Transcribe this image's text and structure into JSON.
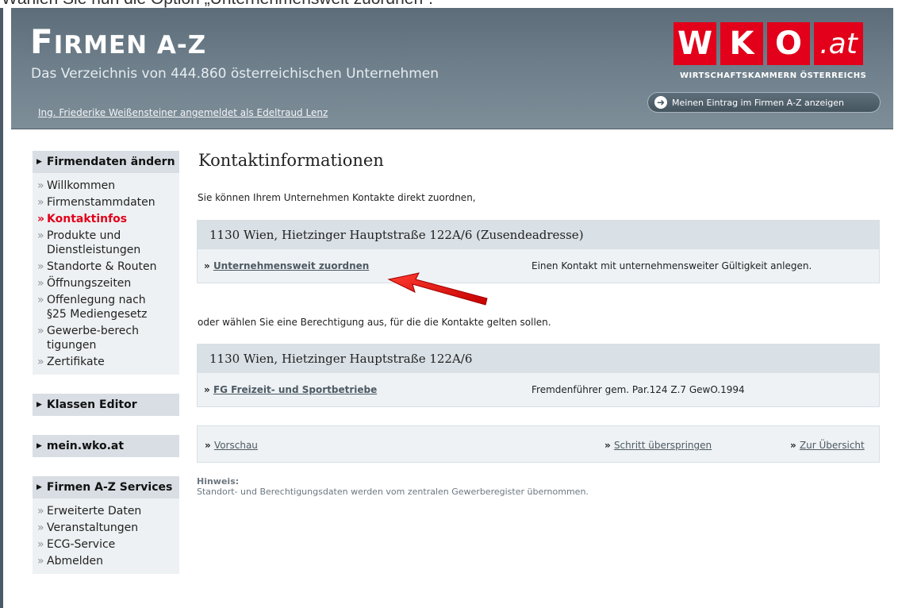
{
  "caption": "Wählen Sie nun die Option „Unternehmensweit zuordnen“.",
  "header": {
    "title_first": "F",
    "title_rest": "IRMEN A-Z",
    "subtitle": "Das Verzeichnis von 444.860 österreichischen Unternehmen",
    "login_text": "Ing. Friederike Weißensteiner angemeldet als Edeltraud Lenz",
    "logo_letters": [
      "W",
      "K",
      "O"
    ],
    "logo_suffix": ".at",
    "logo_tagline": "WIRTSCHAFTSKAMMERN ÖSTERREICHS",
    "show_entry_label": "Meinen Eintrag im Firmen A-Z anzeigen",
    "brand_color": "#e2001a"
  },
  "sidebar": {
    "section1": {
      "title": "Firmendaten ändern",
      "items": [
        "Willkommen",
        "Firmenstammdaten",
        "Kontaktinfos",
        "Produkte und Dienstleistungen",
        "Standorte & Routen",
        "Öffnungszeiten",
        "Offenlegung nach §25 Mediengesetz",
        "Gewerbe-berechtigungen",
        "Zertifikate"
      ],
      "active_index": 2
    },
    "section2": {
      "title": "Klassen Editor"
    },
    "section3": {
      "title": "mein.wko.at"
    },
    "section4": {
      "title": "Firmen A-Z Services",
      "items": [
        "Erweiterte Daten",
        "Veranstaltungen",
        "ECG-Service",
        "Abmelden"
      ]
    }
  },
  "main": {
    "title": "Kontaktinformationen",
    "intro": "Sie können Ihrem Unternehmen Kontakte direkt zuordnen,",
    "panel1": {
      "address": "1130 Wien, Hietzinger Hauptstraße 122A/6 (Zusendeadresse)",
      "link": "Unternehmensweit zuordnen",
      "desc": "Einen Kontakt mit unternehmensweiter Gültigkeit anlegen."
    },
    "mid_text": "oder wählen Sie eine Berechtigung aus, für die die Kontakte gelten sollen.",
    "panel2": {
      "address": "1130 Wien, Hietzinger Hauptstraße 122A/6",
      "link": "FG Freizeit- und Sportbetriebe",
      "desc": "Fremdenführer gem. Par.124 Z.7 GewO.1994"
    },
    "nav": {
      "preview": "Vorschau",
      "skip": "Schritt überspringen",
      "overview": "Zur Übersicht"
    },
    "hint_label": "Hinweis:",
    "hint_text": "Standort- und Berechtigungsdaten werden vom zentralen Gewerberegister übernommen."
  }
}
